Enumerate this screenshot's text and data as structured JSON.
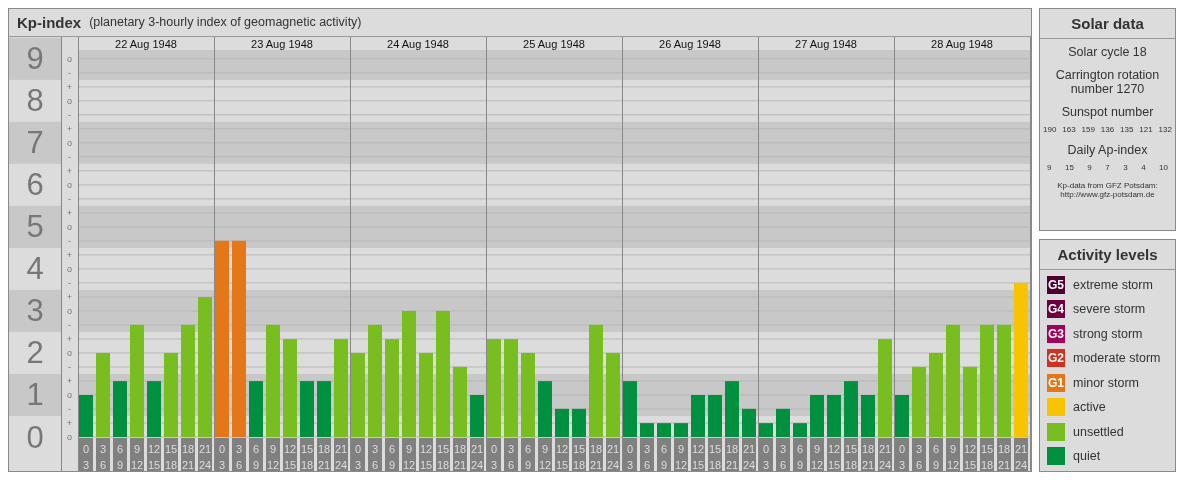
{
  "header": {
    "title": "Kp-index",
    "subtitle": "(planetary 3-hourly index of geomagnetic activity)"
  },
  "chart": {
    "days": [
      "22 Aug 1948",
      "23 Aug 1948",
      "24 Aug 1948",
      "25 Aug 1948",
      "26 Aug 1948",
      "27 Aug 1948",
      "28 Aug 1948"
    ],
    "minor_tick_labels": [
      "o",
      "-",
      "+",
      "o",
      "-",
      "+",
      "o",
      "-",
      "+",
      "o",
      "-",
      "+",
      "o",
      "-",
      "+",
      "o",
      "-",
      "+",
      "o",
      "-",
      "+",
      "o",
      "-",
      "+",
      "o",
      "-",
      "+",
      "o"
    ],
    "chart_data": {
      "type": "bar",
      "grid": true,
      "ylim": [
        0,
        9.21
      ],
      "yticks": [
        0,
        1,
        2,
        3,
        4,
        5,
        6,
        7,
        8,
        9
      ],
      "categories": [
        "0\n3",
        "3\n6",
        "6\n9",
        "9\n12",
        "12\n15",
        "15\n18",
        "18\n21",
        "21\n24",
        "0\n3",
        "3\n6",
        "6\n9",
        "9\n12",
        "12\n15",
        "15\n18",
        "18\n21",
        "21\n24",
        "0\n3",
        "3\n6",
        "6\n9",
        "9\n12",
        "12\n15",
        "15\n18",
        "18\n21",
        "21\n24",
        "0\n3",
        "3\n6",
        "6\n9",
        "9\n12",
        "12\n15",
        "15\n18",
        "18\n21",
        "21\n24",
        "0\n3",
        "3\n6",
        "6\n9",
        "9\n12",
        "12\n15",
        "15\n18",
        "18\n21",
        "21\n24",
        "0\n3",
        "3\n6",
        "6\n9",
        "9\n12",
        "12\n15",
        "15\n18",
        "18\n21",
        "21\n24",
        "0\n3",
        "3\n6",
        "6\n9",
        "9\n12",
        "12\n15",
        "15\n18",
        "18\n21",
        "21\n24"
      ],
      "series": [
        {
          "color": "#009040",
          "values": [
            1,
            null,
            1.33,
            null,
            1.33,
            null,
            null,
            null,
            null,
            null,
            1.33,
            null,
            null,
            1.33,
            1.33,
            null,
            null,
            null,
            null,
            null,
            null,
            null,
            null,
            1,
            null,
            null,
            null,
            1.33,
            0.67,
            0.67,
            null,
            null,
            1.33,
            0.33,
            0.33,
            0.33,
            1,
            1,
            1.33,
            0.67,
            0.33,
            0.67,
            0.33,
            1,
            1,
            1.33,
            1,
            null,
            1,
            null,
            null,
            null,
            null,
            null,
            null,
            null
          ]
        },
        {
          "color": "#78be20",
          "values": [
            null,
            2,
            null,
            2.67,
            null,
            2,
            2.67,
            3.33,
            null,
            null,
            null,
            2.67,
            2.33,
            null,
            null,
            2.33,
            2,
            2.67,
            2.33,
            3,
            2,
            3,
            1.67,
            null,
            2.33,
            2.33,
            2,
            null,
            null,
            null,
            2.67,
            2,
            null,
            null,
            null,
            null,
            null,
            null,
            null,
            null,
            null,
            null,
            null,
            null,
            null,
            null,
            null,
            2.33,
            null,
            1.67,
            2,
            2.67,
            1.67,
            2.67,
            2.67,
            null
          ]
        },
        {
          "color": "#f8c400",
          "values": [
            null,
            null,
            null,
            null,
            null,
            null,
            null,
            null,
            null,
            null,
            null,
            null,
            null,
            null,
            null,
            null,
            null,
            null,
            null,
            null,
            null,
            null,
            null,
            null,
            null,
            null,
            null,
            null,
            null,
            null,
            null,
            null,
            null,
            null,
            null,
            null,
            null,
            null,
            null,
            null,
            null,
            null,
            null,
            null,
            null,
            null,
            null,
            null,
            null,
            null,
            null,
            null,
            null,
            null,
            null,
            3.67
          ]
        },
        {
          "color": "#e47818",
          "values": [
            null,
            null,
            null,
            null,
            null,
            null,
            null,
            null,
            4.67,
            4.67,
            null,
            null,
            null,
            null,
            null,
            null,
            null,
            null,
            null,
            null,
            null,
            null,
            null,
            null,
            null,
            null,
            null,
            null,
            null,
            null,
            null,
            null,
            null,
            null,
            null,
            null,
            null,
            null,
            null,
            null,
            null,
            null,
            null,
            null,
            null,
            null,
            null,
            null,
            null,
            null,
            null,
            null,
            null,
            null,
            null,
            null
          ]
        }
      ]
    }
  },
  "solar_data": {
    "title": "Solar data",
    "solar_cycle": "Solar cycle 18",
    "carrington": "Carrington rotation number 1270",
    "sunspot_label": "Sunspot number",
    "sunspot_numbers": [
      "190",
      "163",
      "159",
      "136",
      "135",
      "121",
      "132"
    ],
    "ap_label": "Daily Ap-index",
    "ap_values": [
      "9",
      "15",
      "9",
      "7",
      "3",
      "4",
      "10"
    ],
    "credit": [
      "Kp-data from GFZ Potsdam:",
      "http://www.gfz-potsdam.de"
    ]
  },
  "activity_levels": {
    "title": "Activity levels",
    "items": [
      {
        "badge": "G5",
        "label": "extreme storm",
        "color": "#4d0030"
      },
      {
        "badge": "G4",
        "label": "severe storm",
        "color": "#6e0040"
      },
      {
        "badge": "G3",
        "label": "strong storm",
        "color": "#a0005a"
      },
      {
        "badge": "G2",
        "label": "moderate storm",
        "color": "#d03020"
      },
      {
        "badge": "G1",
        "label": "minor storm",
        "color": "#e47818"
      },
      {
        "label": "active",
        "color": "#f8c400"
      },
      {
        "label": "unsettled",
        "color": "#78be20"
      },
      {
        "label": "quiet",
        "color": "#009040"
      }
    ]
  }
}
